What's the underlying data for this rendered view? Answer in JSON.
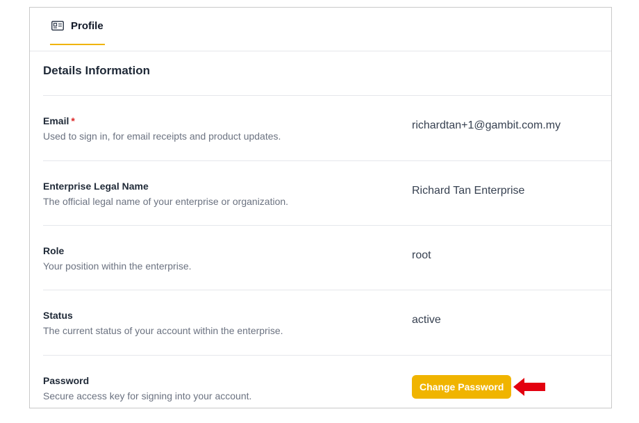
{
  "tabs": [
    {
      "label": "Profile",
      "icon": "id-card-icon",
      "active": true
    }
  ],
  "section": {
    "title": "Details Information"
  },
  "fields": [
    {
      "label": "Email",
      "required_mark": "*",
      "description": "Used to sign in, for email receipts and product updates.",
      "value": "richardtan+1@gambit.com.my"
    },
    {
      "label": "Enterprise Legal Name",
      "description": "The official legal name of your enterprise or organization.",
      "value": "Richard Tan Enterprise"
    },
    {
      "label": "Role",
      "description": "Your position within the enterprise.",
      "value": "root"
    },
    {
      "label": "Status",
      "description": "The current status of your account within the enterprise.",
      "value": "active"
    },
    {
      "label": "Password",
      "description": "Secure access key for signing into your account."
    }
  ],
  "password_action": {
    "label": "Change Password"
  },
  "colors": {
    "accent": "#f0b400",
    "required": "#dc2626",
    "annotation_arrow": "#e3000f"
  }
}
